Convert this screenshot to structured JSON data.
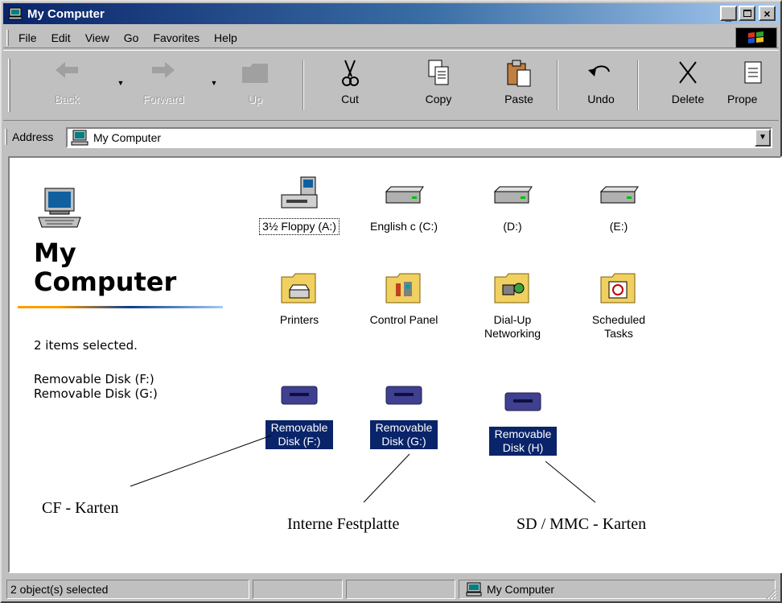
{
  "window": {
    "title": "My Computer"
  },
  "menu": [
    "File",
    "Edit",
    "View",
    "Go",
    "Favorites",
    "Help"
  ],
  "toolbar": {
    "back": "Back",
    "forward": "Forward",
    "up": "Up",
    "cut": "Cut",
    "copy": "Copy",
    "paste": "Paste",
    "undo": "Undo",
    "delete": "Delete",
    "properties": "Prope"
  },
  "address": {
    "label": "Address",
    "value": "My Computer"
  },
  "left_pane": {
    "title_line1": "My",
    "title_line2": "Computer",
    "selection_summary": "2 items selected.",
    "selected_items": [
      "Removable Disk (F:)",
      "Removable Disk (G:)"
    ]
  },
  "items": [
    {
      "label": "3½ Floppy (A:)",
      "icon": "floppy-drive-icon"
    },
    {
      "label": "English c (C:)",
      "icon": "hard-drive-icon"
    },
    {
      "label": "(D:)",
      "icon": "hard-drive-icon"
    },
    {
      "label": "(E:)",
      "icon": "hard-drive-icon"
    },
    {
      "label": "Printers",
      "icon": "printers-folder-icon"
    },
    {
      "label": "Control Panel",
      "icon": "control-panel-folder-icon"
    },
    {
      "label": "Dial-Up Networking",
      "icon": "dial-up-networking-folder-icon"
    },
    {
      "label": "Scheduled Tasks",
      "icon": "scheduled-tasks-folder-icon"
    },
    {
      "label": "Removable Disk (F:)",
      "icon": "removable-disk-icon",
      "selected": true
    },
    {
      "label": "Removable Disk (G:)",
      "icon": "removable-disk-icon",
      "selected": true
    },
    {
      "label": "Removable Disk (H)",
      "icon": "removable-disk-icon",
      "selected": true
    }
  ],
  "annotations": {
    "cf": "CF - Karten",
    "internal": "Interne Festplatte",
    "sd": "SD / MMC - Karten"
  },
  "status": {
    "left": "2 object(s) selected",
    "right": "My Computer"
  },
  "colors": {
    "selection": "#0a246a",
    "desktop_gray": "#c0c0c0",
    "title_start": "#0a246a",
    "title_end": "#a6caf0"
  }
}
